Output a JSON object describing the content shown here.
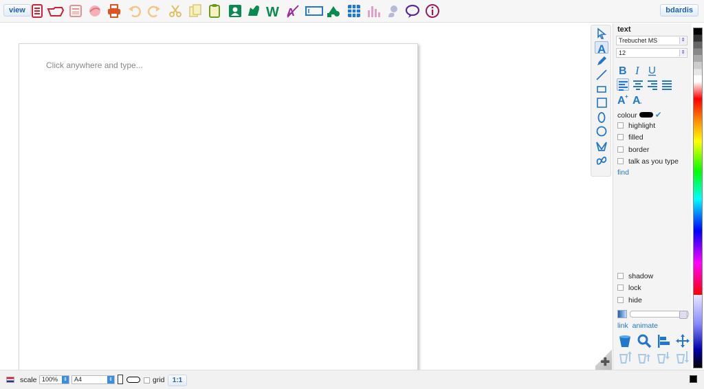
{
  "toolbar": {
    "view_label": "view",
    "user_label": "bdardis",
    "icons": [
      "document-icon",
      "open-folder-icon",
      "template-icon",
      "media-icon",
      "print-icon",
      "undo-icon",
      "redo-icon",
      "cut-icon",
      "copy-icon",
      "paste-icon",
      "photo-icon",
      "map-icon",
      "word-icon",
      "dictionary-icon",
      "textbox-icon",
      "symbols-icon",
      "table-icon",
      "chart-icon",
      "speech-icon",
      "balloon-icon",
      "info-icon"
    ]
  },
  "canvas": {
    "hint": "Click anywhere and type..."
  },
  "tools": [
    "pointer-icon",
    "text-tool-icon",
    "pencil-icon",
    "line-icon",
    "rectangle-thin-icon",
    "square-icon",
    "ellipse-icon",
    "circle-icon",
    "shape-icon",
    "freeform-icon"
  ],
  "panel": {
    "title": "text",
    "font": "Trebuchet MS",
    "size": "12",
    "colour_label": "colour",
    "colour_value": "#000000",
    "highlight": "highlight",
    "filled": "filled",
    "border": "border",
    "talk": "talk as you type",
    "find": "find",
    "shadow": "shadow",
    "lock": "lock",
    "hide": "hide",
    "link": "link",
    "animate": "animate"
  },
  "status": {
    "scale_label": "scale",
    "scale_value": "100%",
    "paper": "A4",
    "grid_label": "grid",
    "ratio_label": "1:1"
  }
}
